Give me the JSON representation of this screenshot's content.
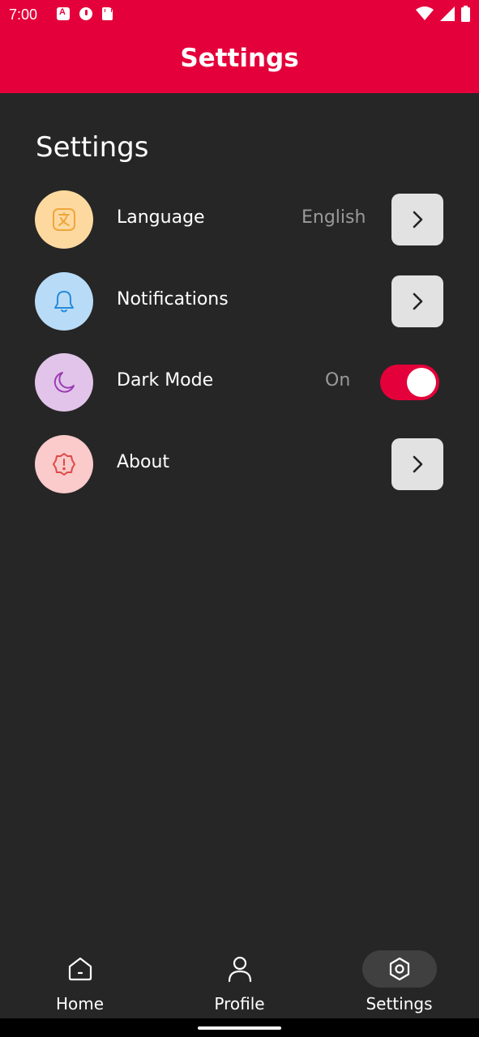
{
  "status_bar": {
    "time": "7:00"
  },
  "app_bar": {
    "title": "Settings"
  },
  "section": {
    "title": "Settings"
  },
  "settings": [
    {
      "label": "Language",
      "value": "English",
      "icon": "translate-icon",
      "icon_bg": "#fdd9a0",
      "icon_color": "#f0a53a",
      "control": "chevron"
    },
    {
      "label": "Notifications",
      "value": "",
      "icon": "bell-icon",
      "icon_bg": "#b8dcf8",
      "icon_color": "#2a8ad8",
      "control": "chevron"
    },
    {
      "label": "Dark Mode",
      "value": "On",
      "icon": "moon-icon",
      "icon_bg": "#e2c4ea",
      "icon_color": "#9a3ab2",
      "control": "toggle",
      "toggle_on": true
    },
    {
      "label": "About",
      "value": "",
      "icon": "alert-badge-icon",
      "icon_bg": "#fbcaca",
      "icon_color": "#e04848",
      "control": "chevron"
    }
  ],
  "bottom_nav": {
    "items": [
      {
        "label": "Home",
        "icon": "home-icon",
        "active": false
      },
      {
        "label": "Profile",
        "icon": "person-icon",
        "active": false
      },
      {
        "label": "Settings",
        "icon": "settings-icon",
        "active": true
      }
    ]
  },
  "colors": {
    "accent": "#e4003a",
    "background": "#262626",
    "chevron_button": "#e2e2e2",
    "muted_text": "#9a9a9a"
  }
}
